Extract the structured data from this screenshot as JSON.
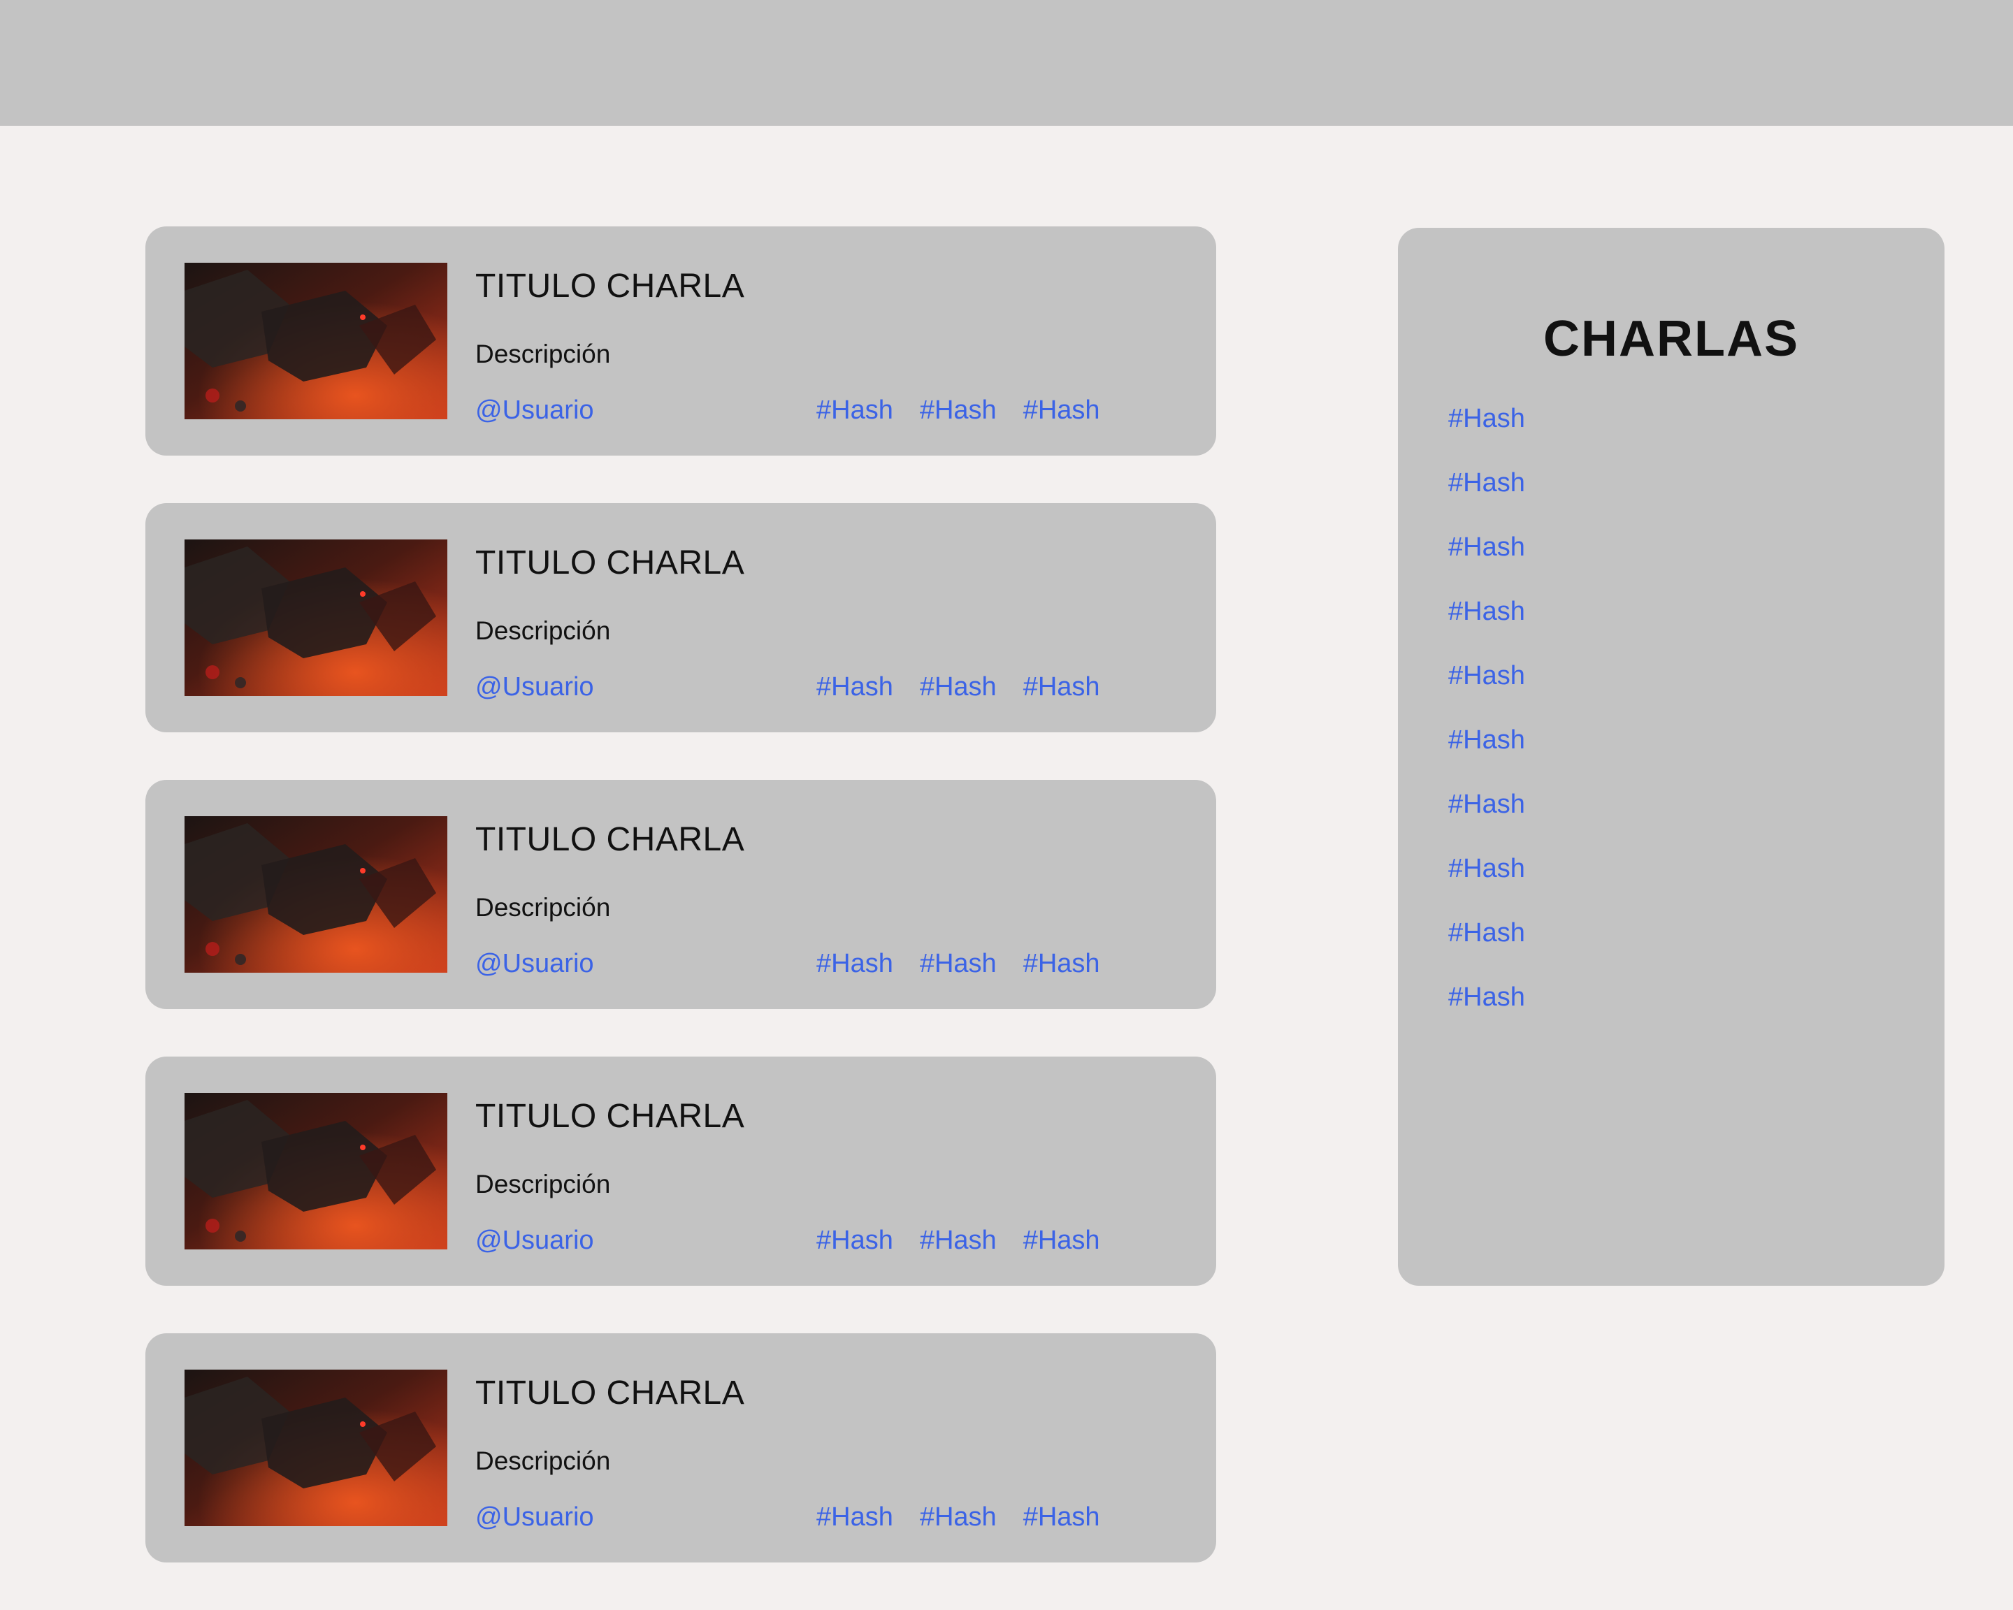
{
  "colors": {
    "page_bg": "#f3f0ef",
    "panel_bg": "#c3c3c3",
    "link": "#3b63e6",
    "text": "#111111"
  },
  "cards": [
    {
      "title": "TITULO CHARLA",
      "description": "Descripción",
      "user": "@Usuario",
      "tags": [
        "#Hash",
        "#Hash",
        "#Hash"
      ]
    },
    {
      "title": "TITULO CHARLA",
      "description": "Descripción",
      "user": "@Usuario",
      "tags": [
        "#Hash",
        "#Hash",
        "#Hash"
      ]
    },
    {
      "title": "TITULO CHARLA",
      "description": "Descripción",
      "user": "@Usuario",
      "tags": [
        "#Hash",
        "#Hash",
        "#Hash"
      ]
    },
    {
      "title": "TITULO CHARLA",
      "description": "Descripción",
      "user": "@Usuario",
      "tags": [
        "#Hash",
        "#Hash",
        "#Hash"
      ]
    },
    {
      "title": "TITULO CHARLA",
      "description": "Descripción",
      "user": "@Usuario",
      "tags": [
        "#Hash",
        "#Hash",
        "#Hash"
      ]
    }
  ],
  "sidebar": {
    "title": "CHARLAS",
    "tags": [
      "#Hash",
      "#Hash",
      "#Hash",
      "#Hash",
      "#Hash",
      "#Hash",
      "#Hash",
      "#Hash",
      "#Hash",
      "#Hash"
    ]
  }
}
